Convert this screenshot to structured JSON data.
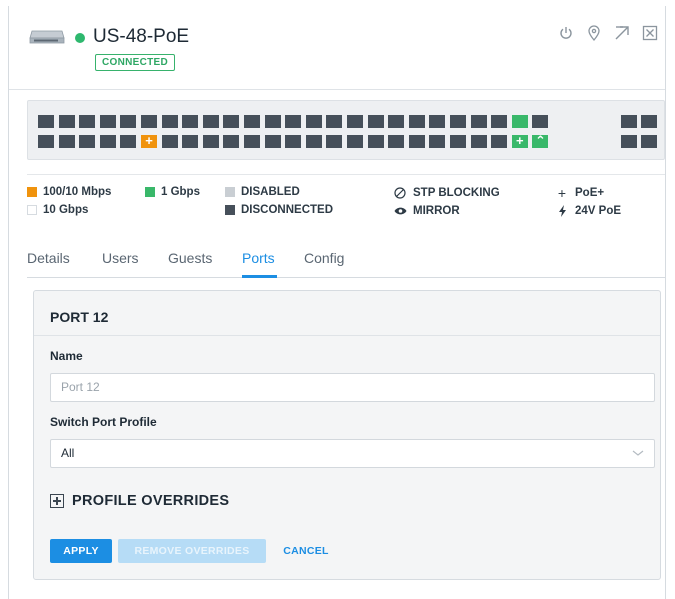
{
  "device": {
    "name": "US-48-PoE",
    "status": "CONNECTED",
    "status_color": "#2eb86e",
    "header_icons": [
      "power-icon",
      "locate-icon",
      "expand-icon",
      "close-icon"
    ]
  },
  "ports": {
    "top_row": [
      "d",
      "d",
      "d",
      "d",
      "d",
      "d",
      "d",
      "d",
      "d",
      "d",
      "d",
      "d",
      "d",
      "d",
      "d",
      "d",
      "d",
      "d",
      "d",
      "d",
      "d",
      "d",
      "d",
      "g",
      "d"
    ],
    "bottom_row": [
      "d",
      "d",
      "d",
      "d",
      "d",
      "o+",
      "d",
      "d",
      "d",
      "d",
      "d",
      "d",
      "d",
      "d",
      "d",
      "d",
      "d",
      "d",
      "d",
      "d",
      "d",
      "d",
      "d",
      "g+",
      "g^"
    ],
    "sfp_top": [
      "d",
      "d"
    ],
    "sfp_bottom": [
      "d",
      "d"
    ],
    "colors": {
      "disconnected": "#46505a",
      "gbps": "#39b86a",
      "fast": "#f0930d",
      "disabled": "#c9ced3"
    }
  },
  "legend": {
    "speed_100_10": "100/10 Mbps",
    "speed_1g": "1 Gbps",
    "speed_10g": "10 Gbps",
    "disabled": "DISABLED",
    "disconnected": "DISCONNECTED",
    "stp": "STP BLOCKING",
    "mirror": "MIRROR",
    "poe_plus": "PoE+",
    "poe_24v": "24V PoE"
  },
  "tabs": [
    {
      "label": "Details",
      "active": false
    },
    {
      "label": "Users",
      "active": false
    },
    {
      "label": "Guests",
      "active": false
    },
    {
      "label": "Ports",
      "active": true
    },
    {
      "label": "Config",
      "active": false
    }
  ],
  "port_form": {
    "title": "PORT 12",
    "name_label": "Name",
    "name_placeholder": "Port 12",
    "profile_label": "Switch Port Profile",
    "profile_value": "All",
    "overrides_label": "PROFILE OVERRIDES",
    "apply": "APPLY",
    "remove_overrides": "REMOVE OVERRIDES",
    "cancel": "CANCEL"
  }
}
